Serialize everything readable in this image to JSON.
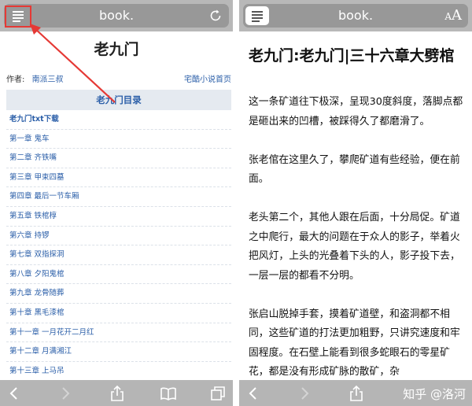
{
  "colors": {
    "accent": "#2a5ea8",
    "highlight": "#e53935",
    "toolbar": "#b5b5b5"
  },
  "left": {
    "address": "book.",
    "refresh_icon": "refresh-icon",
    "site_title": "老九门",
    "author_label": "作者:",
    "author": "南派三叔",
    "home_link": "宅酷小说首页",
    "toc_header": "老九门目录",
    "toc": [
      "老九门txt下载",
      "第一章 鬼车",
      "第二章 齐铁嘴",
      "第三章 甲束四墓",
      "第四章 最后一节车厢",
      "第五章 铁棺椁",
      "第六章 持锣",
      "第七章 双指探洞",
      "第八章 夕阳鬼棺",
      "第九章 龙骨随葬",
      "第十章 黑毛漆棺",
      "第十一章 一月花开二月红",
      "第十二章 月满湘江",
      "第十三章 上马吊"
    ]
  },
  "right": {
    "address": "book.",
    "font_small": "A",
    "font_large": "A",
    "title": "老九门:老九门|三十六章大劈棺",
    "paragraphs": [
      "这一条矿道往下极深，呈现30度斜度，落脚点都是砸出来的凹槽，被踩得久了都磨滑了。",
      "张老倌在这里久了，攀爬矿道有些经验，便在前面。",
      "老头第二个，其他人跟在后面，十分局促。矿道之中爬行，最大的问题在于众人的影子，举着火把风灯，上头的光叠着下头的人，影子投下去，一层一层的都看不分明。",
      "张启山脱掉手套，摸着矿道壁，和盗洞都不相同，这些矿道的打法更加粗野，只讲究速度和牢固程度。在石壁上能看到很多蛇眼石的零星矿花，都是没有形成矿脉的散矿，杂"
    ],
    "watermark": "知乎 @洛河"
  }
}
